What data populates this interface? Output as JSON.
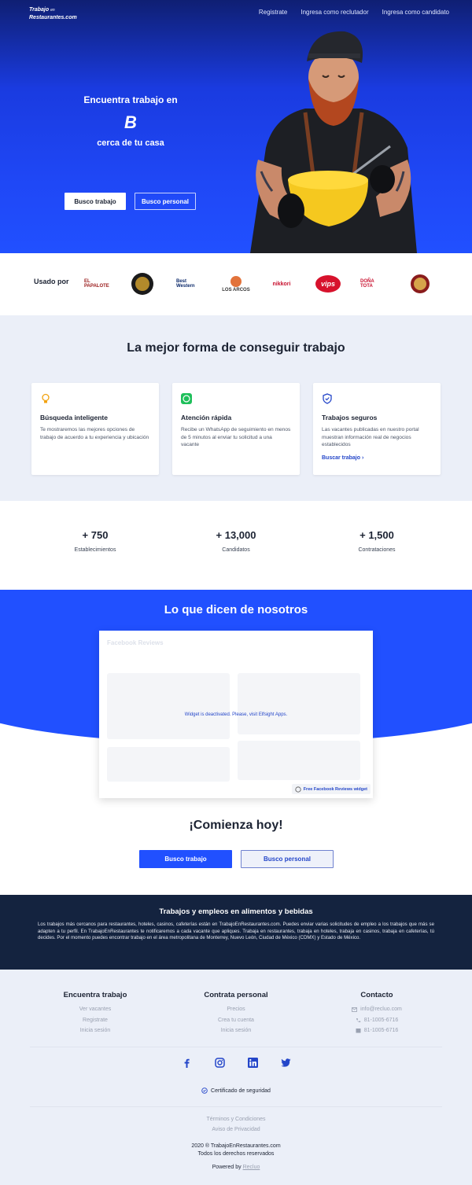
{
  "header": {
    "logo_line1": "Trabajo",
    "logo_line1_small": "en",
    "logo_line2": "Restaurantes.com",
    "nav": [
      "Registrate",
      "Ingresa como reclutador",
      "Ingresa como candidato"
    ]
  },
  "hero": {
    "title_top": "Encuentra trabajo en",
    "title_word": "B",
    "title_bottom": "cerca de tu casa",
    "btn_primary": "Busco trabajo",
    "btn_secondary": "Busco personal"
  },
  "logos": {
    "label": "Usado por",
    "brands": [
      "EL PAPALOTE",
      "SIETE MARES",
      "Best Western",
      "LOS ARCOS",
      "nikkori",
      "vips",
      "DOÑA TOTA",
      "TM"
    ]
  },
  "features": {
    "title": "La mejor forma de conseguir trabajo",
    "cards": [
      {
        "icon": "lightbulb-icon",
        "title": "Búsqueda inteligente",
        "text": "Te mostraremos las mejores opciones de trabajo de acuerdo a tu experiencia y ubicación",
        "link": ""
      },
      {
        "icon": "whatsapp-icon",
        "title": "Atención rápida",
        "text": "Recibe un WhatsApp de seguimiento en menos de 5 minutos al enviar tu solicitud a una vacante",
        "link": ""
      },
      {
        "icon": "shield-icon",
        "title": "Trabajos seguros",
        "text": "Las vacantes publicadas en nuestro portal muestran información real de negocios establecidos",
        "link": "Buscar trabajo"
      }
    ]
  },
  "stats": [
    {
      "num": "+ 750",
      "label": "Establecimientos"
    },
    {
      "num": "+ 13,000",
      "label": "Candidatos"
    },
    {
      "num": "+ 1,500",
      "label": "Contrataciones"
    }
  ],
  "testimonials": {
    "title": "Lo que dicen de nosotros",
    "widget_title": "Facebook Reviews",
    "deactivated": "Widget is deactivated. Please, visit Elfsight Apps.",
    "free_tag": "Free Facebook Reviews widget"
  },
  "cta": {
    "title": "¡Comienza hoy!",
    "btn_primary": "Busco trabajo",
    "btn_secondary": "Busco personal"
  },
  "seo": {
    "title": "Trabajos y empleos en alimentos y bebidas",
    "text": "Los trabajos más cercanos para restaurantes, hoteles, casinos, cafeterías están en TrabajoEnRestaurantes.com. Puedes enviar varias solicitudes de empleo a los trabajos que más se adapten a tu perfil. En TrabajoEnRestaurantes te notificaremos a cada vacante que apliques. Trabaja en restaurantes, trabaja en hoteles, trabaja en casinos, trabaja en cafeterías, tú decides. Por el momento puedes encontrar trabajo en el área metropolitana de Monterrey, Nuevo León, Ciudad de México (CDMX) y Estado de México."
  },
  "footer": {
    "col1": {
      "title": "Encuentra trabajo",
      "links": [
        "Ver vacantes",
        "Registrate",
        "Inicia sesión"
      ]
    },
    "col2": {
      "title": "Contrata personal",
      "links": [
        "Precios",
        "Crea tu cuenta",
        "Inicia sesión"
      ]
    },
    "col3": {
      "title": "Contacto",
      "links": [
        "info@recluo.com",
        "81-1005-6716",
        "81-1005-6716"
      ]
    },
    "cert": "Certificado de seguridad",
    "legal": [
      "Términos y Condiciones",
      "Aviso de Privacidad"
    ],
    "copy1": "2020 ® TrabajoEnRestaurantes.com",
    "copy2": "Todos los derechos reservados",
    "powered_label": "Powered by",
    "powered_link": "Recluo"
  },
  "colors": {
    "primary": "#2150ff",
    "dark": "#14233f",
    "light_bg": "#ebeff8"
  }
}
